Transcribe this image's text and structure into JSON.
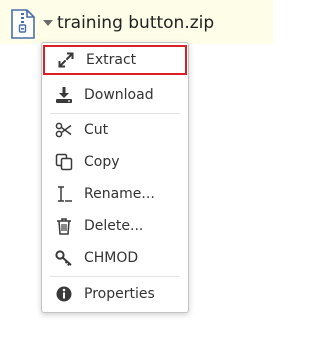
{
  "file": {
    "name": "training button.zip",
    "icon": "zip-file-icon"
  },
  "context_menu": {
    "items": [
      {
        "label": "Extract",
        "icon": "expand-arrows-icon",
        "highlighted": true
      },
      {
        "label": "Download",
        "icon": "download-icon"
      },
      {
        "label": "Cut",
        "icon": "scissors-icon"
      },
      {
        "label": "Copy",
        "icon": "copy-icon"
      },
      {
        "label": "Rename...",
        "icon": "text-cursor-icon"
      },
      {
        "label": "Delete...",
        "icon": "trash-icon"
      },
      {
        "label": "CHMOD",
        "icon": "key-icon"
      },
      {
        "label": "Properties",
        "icon": "info-icon"
      }
    ]
  },
  "colors": {
    "highlight_border": "#d81f26",
    "header_background": "#fdfde8",
    "icon_blue": "#4a6fa5"
  }
}
